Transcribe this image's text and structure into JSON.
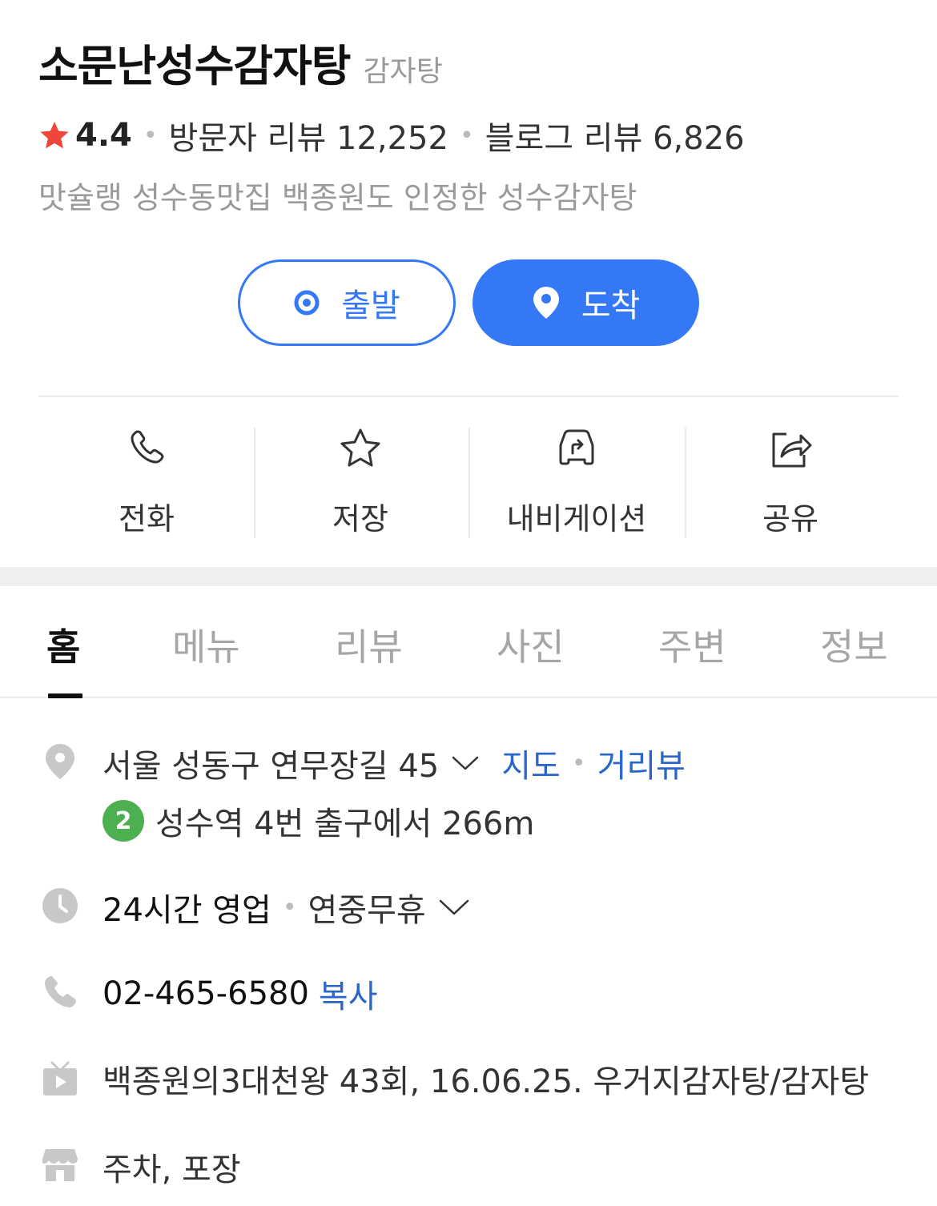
{
  "place": {
    "name": "소문난성수감자탕",
    "category": "감자탕",
    "rating": "4.4",
    "visitor_reviews": "방문자 리뷰 12,252",
    "blog_reviews": "블로그 리뷰 6,826",
    "description": "맛슐랭 성수동맛집 백종원도 인정한 성수감자탕"
  },
  "route": {
    "start_label": "출발",
    "arrive_label": "도착"
  },
  "actions": [
    {
      "label": "전화",
      "icon": "phone-icon"
    },
    {
      "label": "저장",
      "icon": "star-outline-icon"
    },
    {
      "label": "내비게이션",
      "icon": "car-navigation-icon"
    },
    {
      "label": "공유",
      "icon": "share-icon"
    }
  ],
  "tabs": [
    {
      "label": "홈",
      "active": true
    },
    {
      "label": "메뉴"
    },
    {
      "label": "리뷰"
    },
    {
      "label": "사진"
    },
    {
      "label": "주변"
    },
    {
      "label": "정보"
    }
  ],
  "info": {
    "address": "서울 성동구 연무장길 45",
    "map_link": "지도",
    "street_view_link": "거리뷰",
    "subway_line": "2",
    "subway_text": "성수역 4번 출구에서 266m",
    "hours_main": "24시간 영업",
    "hours_sub": "연중무휴",
    "phone": "02-465-6580",
    "copy_label": "복사",
    "tv": "백종원의3대천왕 43회, 16.06.25. 우거지감자탕/감자탕",
    "facilities": "주차, 포장"
  },
  "colors": {
    "accent": "#3478f6",
    "link": "#2a66c9",
    "star": "#f0453a",
    "subway_line2": "#4caf50",
    "muted": "#999999"
  }
}
